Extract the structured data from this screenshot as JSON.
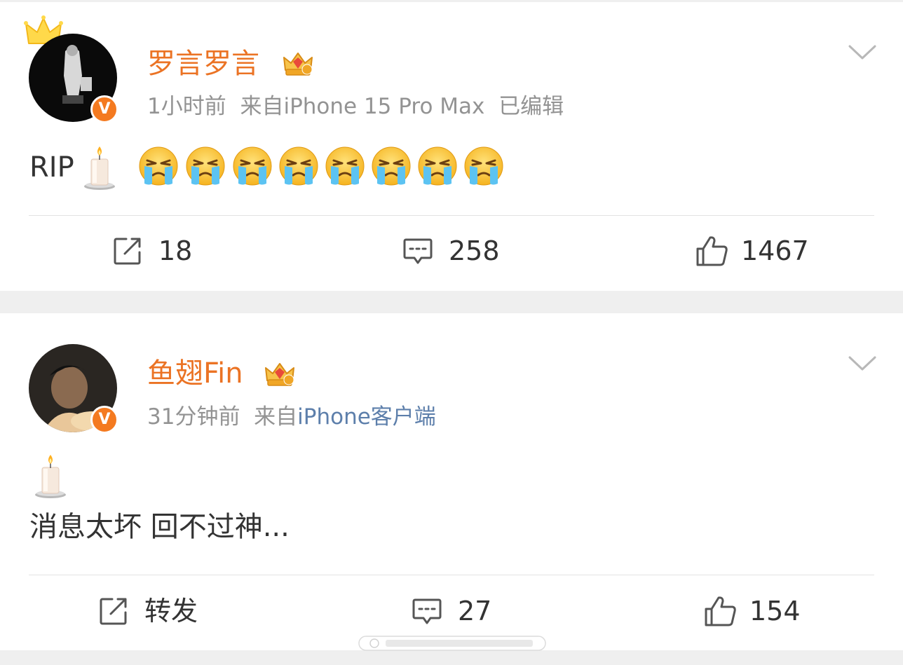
{
  "posts": [
    {
      "username": "罗言罗言",
      "member_badge_level": "6",
      "time": "1小时前",
      "source_prefix": "来自",
      "source": "iPhone 15 Pro Max",
      "edited": "已编辑",
      "text": "RIP",
      "emoji": [
        "candle",
        "crying-face",
        "crying-face",
        "crying-face",
        "crying-face",
        "crying-face",
        "crying-face",
        "crying-face",
        "crying-face"
      ],
      "actions": {
        "repost": "18",
        "comment": "258",
        "like": "1467"
      }
    },
    {
      "username": "鱼翅Fin",
      "member_badge_level": "7",
      "time": "31分钟前",
      "source_prefix": "来自",
      "source": "iPhone客户端",
      "text": "消息太坏 回不过神...",
      "emoji": [
        "candle"
      ],
      "actions": {
        "repost": "转发",
        "comment": "27",
        "like": "154"
      }
    }
  ],
  "verified_mark": "V",
  "icons": [
    "crown-icon",
    "verified-icon",
    "member-crown-badge-icon",
    "chevron-down-icon",
    "candle-emoji-icon",
    "crying-face-emoji-icon",
    "repost-icon",
    "comment-icon",
    "like-icon"
  ],
  "colors": {
    "username": "#eb7324",
    "verified_badge": "#f47a20",
    "meta_text": "#939393",
    "source_link": "#5d7fab",
    "divider": "#e3e3e3",
    "page_bg": "#efefef"
  }
}
